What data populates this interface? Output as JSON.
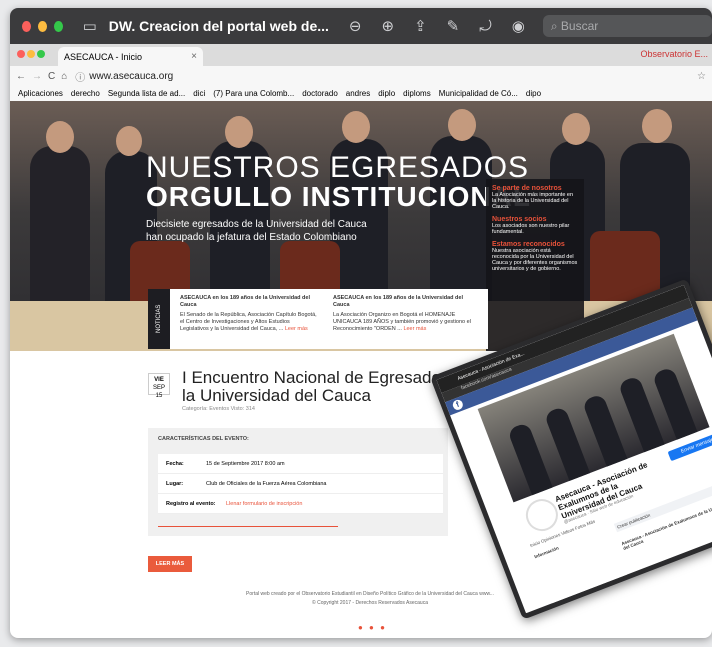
{
  "outer_window": {
    "title": "DW. Creacion del portal web de...",
    "search_placeholder": "Buscar"
  },
  "browser": {
    "tab_title": "ASECAUCA - Inicio",
    "tab_close": "×",
    "other_tab": "Observatorio E...",
    "url": "www.asecauca.org",
    "bookmarks": [
      "Aplicaciones",
      "derecho",
      "Segunda lista de ad...",
      "dici",
      "(7) Para una Colomb...",
      "doctorado",
      "andres",
      "diplo",
      "diploms",
      "Municipalidad de Có...",
      "dipo"
    ]
  },
  "hero": {
    "title_line1": "NUESTROS EGRESADOS",
    "title_line2": "ORGULLO INSTITUCIONAL",
    "subtitle": "Diecisiete egresados de la Universidad del Cauca han ocupado la jefatura del Estado Colombiano"
  },
  "side_box": {
    "h1": "Se parte de nosotros",
    "t1": "La Asociación más importante en la historia de la Universidad del Cauca.",
    "h2": "Nuestros socios",
    "t2": "Los asociados son nuestro pilar fundamental.",
    "h3": "Estamos reconocidos",
    "t3": "Nuestra asociación está reconocida por la Universidad del Cauca y por diferentes organismos universitarios y de gobierno."
  },
  "news": {
    "tab": "NOTICIAS",
    "items": [
      {
        "title": "ASECAUCA en los 189 años de la Universidad del Cauca",
        "body": "El Senado de la República, Asociación Capítulo Bogotá, el Centro de Investigaciones y Altos Estudios Legislativos y la Universidad del Cauca, ...",
        "more": "Leer más"
      },
      {
        "title": "ASECAUCA en los 189 años de la Universidad del Cauca",
        "body": "La Asociación Organizo en Bogotá el HOMENAJE UNICAUCA 189 AÑOS y también promovió y gestiono el Reconocimiento \"ORDEN ...",
        "more": "Leer más"
      }
    ]
  },
  "event": {
    "day": "VIE",
    "date": "SEP 15",
    "title": "I Encuentro Nacional de Egresados de la Universidad del Cauca",
    "meta": "Categoría: Eventos    Visto: 314",
    "details_heading": "CARACTERÍSTICAS DEL EVENTO:",
    "rows": [
      {
        "label": "Fecha:",
        "value": "15 de Septiembre 2017   8:00 am"
      },
      {
        "label": "Lugar:",
        "value": "Club de Oficiales de la Fuerza Aérea Colombiana"
      },
      {
        "label": "Registro al evento:",
        "value": "Llenar formulario de inscripción"
      }
    ],
    "button": "LEER MÁS"
  },
  "footer": {
    "line1": "Portal web creado por el Observatorio Estudiantil en Diseño Político Gráfico de la Universidad del Cauca www...",
    "line2": "© Copyright 2017 - Derechos Reservados Asecauca"
  },
  "facebook": {
    "tab": "Asecauca - Asociación de Exa...",
    "url": "facebook.com/asecauca",
    "page_name": "Asecauca - Asociación de Exalumnos de la Universidad del Cauca",
    "handle": "@asecauca · Sitio web de educación",
    "button": "Enviar mensaje",
    "nav": "Inicio   Opiniones   Videos   Fotos   Más",
    "info_heading": "Información",
    "post_heading": "Crear publicación",
    "post_title": "Asecauca - Asociación de Exalumnos de la Universidad del Cauca"
  },
  "colors": {
    "accent": "#e8523a",
    "fb_blue": "#3b5998"
  }
}
